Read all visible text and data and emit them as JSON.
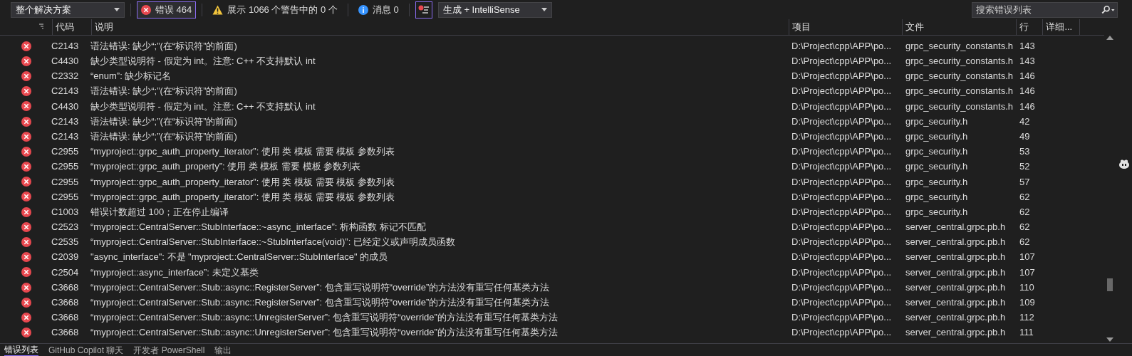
{
  "toolbar": {
    "scope": "整个解决方案",
    "filters": [
      {
        "kind": "error",
        "label": "错误 464",
        "selected": true
      },
      {
        "kind": "warning",
        "label": "展示 1066 个警告中的 0 个",
        "selected": false
      },
      {
        "kind": "info",
        "label": "消息 0",
        "selected": false
      }
    ],
    "filter_toggle": {
      "selected": true
    },
    "build": "生成 + IntelliSense",
    "search": {
      "placeholder": "搜索错误列表"
    }
  },
  "table": {
    "columns": [
      "代码",
      "说明",
      "项目",
      "文件",
      "行",
      "详细..."
    ],
    "rows": [
      {
        "code": "C2143",
        "description": "语法错误: 缺少“;”(在“标识符”的前面)",
        "project": "D:\\Project\\cpp\\APP\\po...",
        "file": "grpc_security_constants.h",
        "line": "143"
      },
      {
        "code": "C4430",
        "description": "缺少类型说明符 - 假定为 int。注意: C++ 不支持默认 int",
        "project": "D:\\Project\\cpp\\APP\\po...",
        "file": "grpc_security_constants.h",
        "line": "143"
      },
      {
        "code": "C2332",
        "description": "“enum”: 缺少标记名",
        "project": "D:\\Project\\cpp\\APP\\po...",
        "file": "grpc_security_constants.h",
        "line": "146"
      },
      {
        "code": "C2143",
        "description": "语法错误: 缺少“;”(在“标识符”的前面)",
        "project": "D:\\Project\\cpp\\APP\\po...",
        "file": "grpc_security_constants.h",
        "line": "146"
      },
      {
        "code": "C4430",
        "description": "缺少类型说明符 - 假定为 int。注意: C++ 不支持默认 int",
        "project": "D:\\Project\\cpp\\APP\\po...",
        "file": "grpc_security_constants.h",
        "line": "146"
      },
      {
        "code": "C2143",
        "description": "语法错误: 缺少“;”(在“标识符”的前面)",
        "project": "D:\\Project\\cpp\\APP\\po...",
        "file": "grpc_security.h",
        "line": "42"
      },
      {
        "code": "C2143",
        "description": "语法错误: 缺少“;”(在“标识符”的前面)",
        "project": "D:\\Project\\cpp\\APP\\po...",
        "file": "grpc_security.h",
        "line": "49"
      },
      {
        "code": "C2955",
        "description": "“myproject::grpc_auth_property_iterator”: 使用 类 模板 需要 模板 参数列表",
        "project": "D:\\Project\\cpp\\APP\\po...",
        "file": "grpc_security.h",
        "line": "53"
      },
      {
        "code": "C2955",
        "description": "“myproject::grpc_auth_property”: 使用 类 模板 需要 模板 参数列表",
        "project": "D:\\Project\\cpp\\APP\\po...",
        "file": "grpc_security.h",
        "line": "52"
      },
      {
        "code": "C2955",
        "description": "“myproject::grpc_auth_property_iterator”: 使用 类 模板 需要 模板 参数列表",
        "project": "D:\\Project\\cpp\\APP\\po...",
        "file": "grpc_security.h",
        "line": "57"
      },
      {
        "code": "C2955",
        "description": "“myproject::grpc_auth_property_iterator”: 使用 类 模板 需要 模板 参数列表",
        "project": "D:\\Project\\cpp\\APP\\po...",
        "file": "grpc_security.h",
        "line": "62"
      },
      {
        "code": "C1003",
        "description": "错误计数超过 100；正在停止编译",
        "project": "D:\\Project\\cpp\\APP\\po...",
        "file": "grpc_security.h",
        "line": "62"
      },
      {
        "code": "C2523",
        "description": "“myproject::CentralServer::StubInterface::~async_interface”: 析构函数 标记不匹配",
        "project": "D:\\Project\\cpp\\APP\\po...",
        "file": "server_central.grpc.pb.h",
        "line": "62"
      },
      {
        "code": "C2535",
        "description": "“myproject::CentralServer::StubInterface::~StubInterface(void)”: 已经定义或声明成员函数",
        "project": "D:\\Project\\cpp\\APP\\po...",
        "file": "server_central.grpc.pb.h",
        "line": "62"
      },
      {
        "code": "C2039",
        "description": "\"async_interface\": 不是 \"myproject::CentralServer::StubInterface\" 的成员",
        "project": "D:\\Project\\cpp\\APP\\po...",
        "file": "server_central.grpc.pb.h",
        "line": "107"
      },
      {
        "code": "C2504",
        "description": "“myproject::async_interface”: 未定义基类",
        "project": "D:\\Project\\cpp\\APP\\po...",
        "file": "server_central.grpc.pb.h",
        "line": "107"
      },
      {
        "code": "C3668",
        "description": "“myproject::CentralServer::Stub::async::RegisterServer”: 包含重写说明符“override”的方法没有重写任何基类方法",
        "project": "D:\\Project\\cpp\\APP\\po...",
        "file": "server_central.grpc.pb.h",
        "line": "110"
      },
      {
        "code": "C3668",
        "description": "“myproject::CentralServer::Stub::async::RegisterServer”: 包含重写说明符“override”的方法没有重写任何基类方法",
        "project": "D:\\Project\\cpp\\APP\\po...",
        "file": "server_central.grpc.pb.h",
        "line": "109"
      },
      {
        "code": "C3668",
        "description": "“myproject::CentralServer::Stub::async::UnregisterServer”: 包含重写说明符“override”的方法没有重写任何基类方法",
        "project": "D:\\Project\\cpp\\APP\\po...",
        "file": "server_central.grpc.pb.h",
        "line": "112"
      },
      {
        "code": "C3668",
        "description": "“myproject::CentralServer::Stub::async::UnregisterServer”: 包含重写说明符“override”的方法没有重写任何基类方法",
        "project": "D:\\Project\\cpp\\APP\\po...",
        "file": "server_central.grpc.pb.h",
        "line": "111"
      }
    ]
  },
  "bottom_tabs": [
    {
      "label": "错误列表",
      "selected": true
    },
    {
      "label": "GitHub Copilot 聊天",
      "selected": false
    },
    {
      "label": "开发者 PowerShell",
      "selected": false
    },
    {
      "label": "输出",
      "selected": false
    }
  ]
}
